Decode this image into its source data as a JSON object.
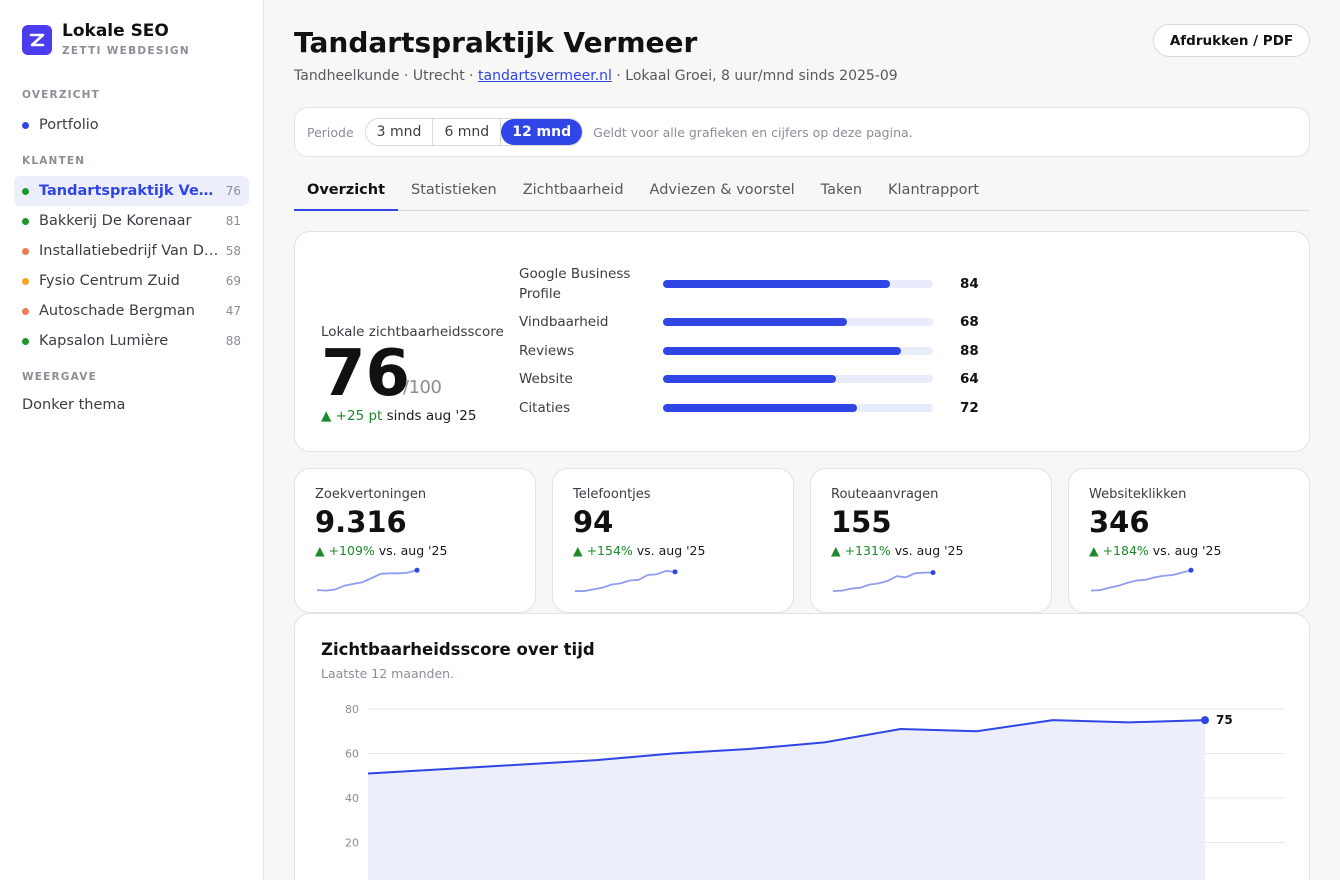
{
  "brand": {
    "title": "Lokale SEO",
    "subtitle": "ZETTI WEBDESIGN",
    "logo_letter": "Z",
    "color": "#4a3df0"
  },
  "sidebar": {
    "overview_label": "OVERZICHT",
    "portfolio": "Portfolio",
    "clients_label": "KLANTEN",
    "clients": [
      {
        "name": "Tandartspraktijk Vermeer",
        "count": "76",
        "dot": "#1b9a2a",
        "active": true
      },
      {
        "name": "Bakkerij De Korenaar",
        "count": "81",
        "dot": "#1b9a2a"
      },
      {
        "name": "Installatiebedrijf Van Dijk",
        "count": "58",
        "dot": "#ee7b55"
      },
      {
        "name": "Fysio Centrum Zuid",
        "count": "69",
        "dot": "#f5a623"
      },
      {
        "name": "Autoschade Bergman",
        "count": "47",
        "dot": "#ee7b55"
      },
      {
        "name": "Kapsalon Lumière",
        "count": "88",
        "dot": "#1b9a2a"
      }
    ],
    "display_label": "WEERGAVE",
    "dark_theme": "Donker thema"
  },
  "header": {
    "title": "Tandartspraktijk Vermeer",
    "meta_prefix": "Tandheelkunde · Utrecht · ",
    "meta_link": "tandartsvermeer.nl",
    "meta_suffix": " · Lokaal Groei, 8 uur/mnd sinds 2025-09",
    "print_button": "Afdrukken / PDF"
  },
  "period": {
    "label": "Periode",
    "options": [
      "3 mnd",
      "6 mnd",
      "12 mnd"
    ],
    "selected": "12 mnd",
    "note": "Geldt voor alle grafieken en cijfers op deze pagina."
  },
  "tabs": [
    "Overzicht",
    "Statistieken",
    "Zichtbaarheid",
    "Adviezen & voorstel",
    "Taken",
    "Klantrapport"
  ],
  "active_tab": "Overzicht",
  "score": {
    "label": "Lokale zichtbaarheidsscore",
    "value": "76",
    "max": "/100",
    "delta": "▲ +25 pt",
    "delta_suffix": " sinds aug '25",
    "breakdown": [
      {
        "name": "Google Business Profile",
        "value": 84
      },
      {
        "name": "Vindbaarheid",
        "value": 68
      },
      {
        "name": "Reviews",
        "value": 88
      },
      {
        "name": "Website",
        "value": 64
      },
      {
        "name": "Citaties",
        "value": 72
      }
    ]
  },
  "kpis": [
    {
      "label": "Zoekvertoningen",
      "value": "9.316",
      "delta": "▲ +109%",
      "suffix": " vs. aug '25",
      "trend": [
        0.12,
        0.1,
        0.15,
        0.3,
        0.38,
        0.45,
        0.62,
        0.8,
        0.82,
        0.82,
        0.85,
        0.95
      ]
    },
    {
      "label": "Telefoontjes",
      "value": "94",
      "delta": "▲ +154%",
      "suffix": " vs. aug '25",
      "trend": [
        0.08,
        0.08,
        0.15,
        0.22,
        0.35,
        0.4,
        0.52,
        0.55,
        0.75,
        0.78,
        0.92,
        0.88
      ]
    },
    {
      "label": "Routeaanvragen",
      "value": "155",
      "delta": "▲ +131%",
      "suffix": " vs. aug '25",
      "trend": [
        0.08,
        0.1,
        0.18,
        0.22,
        0.35,
        0.4,
        0.5,
        0.7,
        0.65,
        0.82,
        0.85,
        0.85
      ]
    },
    {
      "label": "Websiteklikken",
      "value": "346",
      "delta": "▲ +184%",
      "suffix": " vs. aug '25",
      "trend": [
        0.1,
        0.12,
        0.22,
        0.3,
        0.42,
        0.52,
        0.55,
        0.65,
        0.72,
        0.75,
        0.85,
        0.95
      ]
    }
  ],
  "accent": "#2f45e6",
  "positive_color": "#1b8a2a",
  "chart_data": {
    "type": "area",
    "title": "Zichtbaarheidsscore over tijd",
    "subtitle": "Laatste 12 maanden.",
    "y_ticks": [
      80,
      60,
      40,
      20
    ],
    "ylim": [
      0,
      80
    ],
    "values": [
      51,
      53,
      55,
      57,
      60,
      62,
      65,
      71,
      70,
      75,
      74,
      75
    ],
    "end_label": "75",
    "grid": true
  }
}
